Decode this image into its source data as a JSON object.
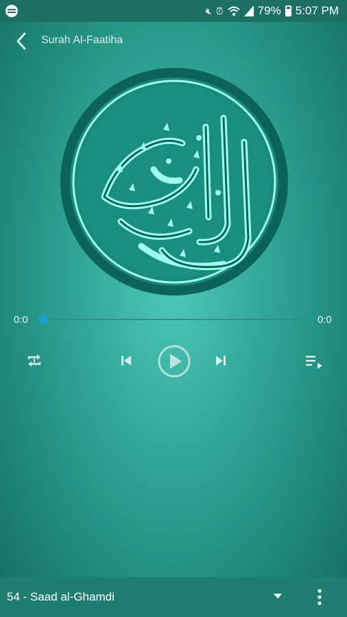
{
  "status": {
    "battery": "79%",
    "time": "5:07 PM",
    "icons": [
      "globe-icon",
      "mute-icon",
      "alarm-icon",
      "wifi-icon",
      "signal-icon",
      "battery-icon"
    ]
  },
  "appbar": {
    "title": "Surah Al-Faatiha",
    "back_icon": "chevron-left-icon"
  },
  "player": {
    "elapsed": "0:0",
    "duration": "0:0",
    "progress": 0,
    "controls": [
      "repeat-icon",
      "skip-previous-icon",
      "play-icon",
      "skip-next-icon",
      "playlist-icon"
    ]
  },
  "bottom": {
    "reciter": "54 - Saad al-Ghamdi",
    "dropdown_icon": "caret-down-icon",
    "menu_icon": "more-vertical-icon"
  },
  "colors": {
    "status_bar": "#1b6f63",
    "bottom_bar": "#1f7e70",
    "accent": "#1aa0cc",
    "logo_light": "#9fffee",
    "logo_dark": "#0c6458"
  }
}
